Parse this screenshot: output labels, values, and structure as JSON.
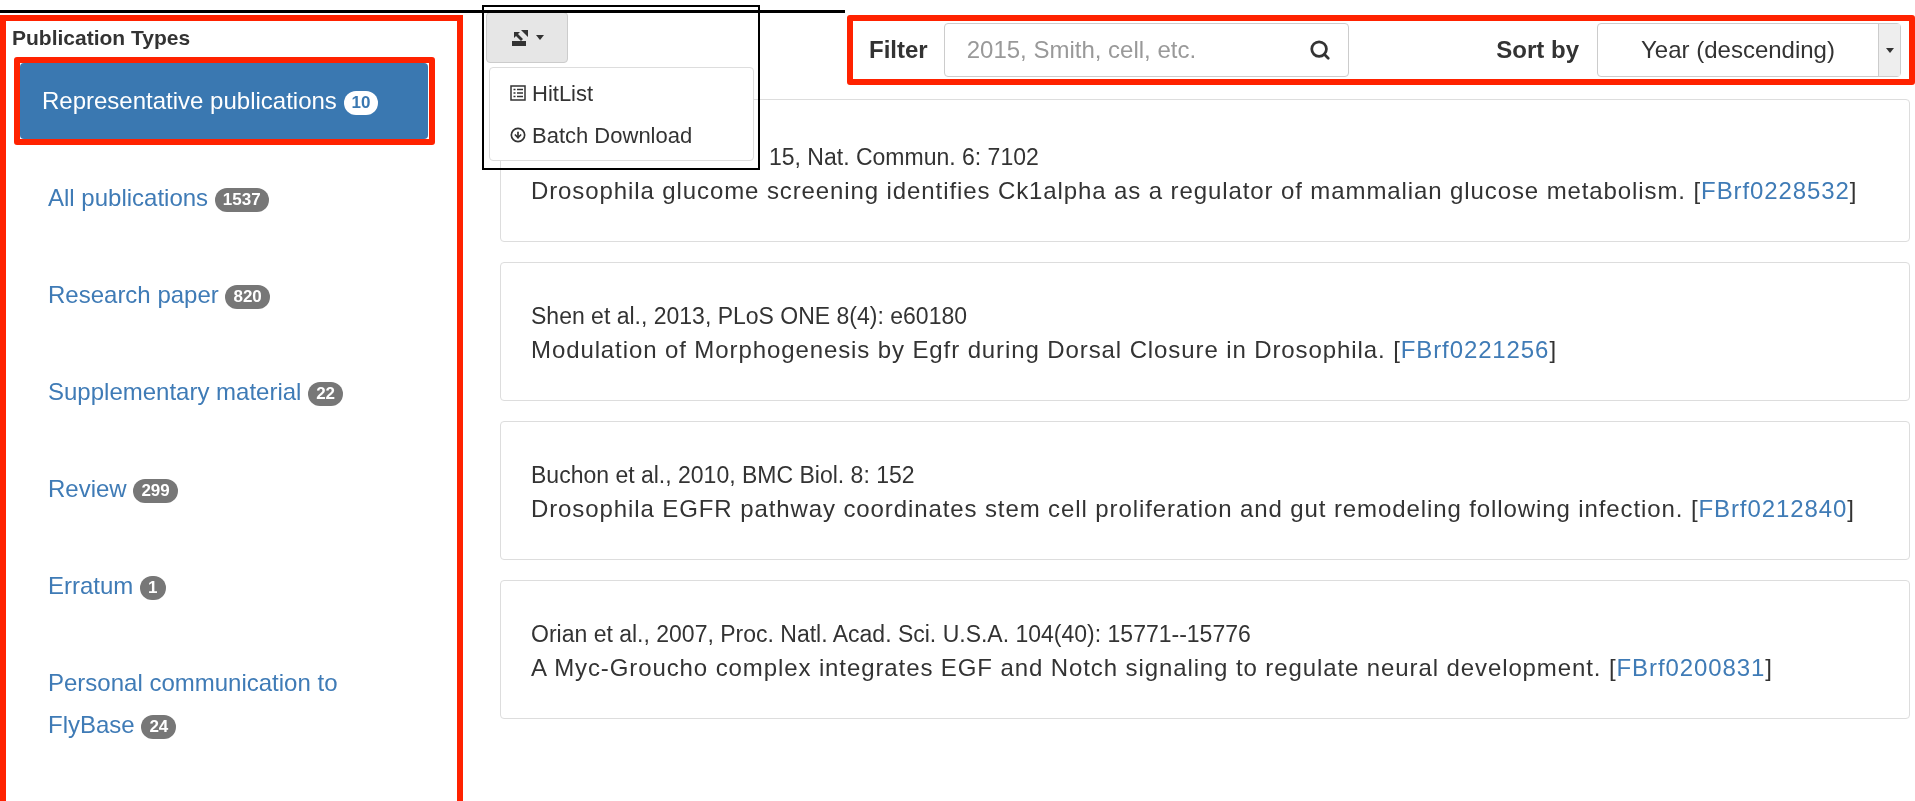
{
  "sidebar": {
    "title": "Publication Types",
    "items": [
      {
        "label": "Representative publications",
        "count": "10",
        "selected": true
      },
      {
        "label": "All publications",
        "count": "1537",
        "selected": false
      },
      {
        "label": "Research paper",
        "count": "820",
        "selected": false
      },
      {
        "label": "Supplementary material",
        "count": "22",
        "selected": false
      },
      {
        "label": "Review",
        "count": "299",
        "selected": false
      },
      {
        "label": "Erratum",
        "count": "1",
        "selected": false
      },
      {
        "label": "Personal communication to FlyBase",
        "count": "24",
        "selected": false
      }
    ]
  },
  "export_menu": {
    "items": [
      {
        "kind": "list",
        "label": "HitList"
      },
      {
        "kind": "download",
        "label": "Batch Download"
      }
    ]
  },
  "filter": {
    "label": "Filter",
    "placeholder": "2015, Smith, cell, etc."
  },
  "sort": {
    "label": "Sort by",
    "value": "Year (descending)"
  },
  "publications": [
    {
      "citation": "15, Nat. Commun. 6: 7102",
      "title": "Drosophila glucome screening identifies Ck1alpha as a regulator of mammalian glucose metabolism.",
      "open": "[",
      "ref": "FBrf0228532",
      "close": "]"
    },
    {
      "citation": "Shen et al., 2013, PLoS ONE 8(4): e60180",
      "title": "Modulation of Morphogenesis by Egfr during Dorsal Closure in Drosophila.",
      "open": "[",
      "ref": "FBrf0221256",
      "close": "]"
    },
    {
      "citation": "Buchon et al., 2010, BMC Biol. 8: 152",
      "title": "Drosophila EGFR pathway coordinates stem cell proliferation and gut remodeling following infection.",
      "open": "[",
      "ref": "FBrf0212840",
      "close": "]"
    },
    {
      "citation": "Orian et al., 2007, Proc. Natl. Acad. Sci. U.S.A. 104(40): 15771--15776",
      "title": "A Myc-Groucho complex integrates EGF and Notch signaling to regulate neural development.",
      "open": "[",
      "ref": "FBrf0200831",
      "close": "]"
    }
  ]
}
